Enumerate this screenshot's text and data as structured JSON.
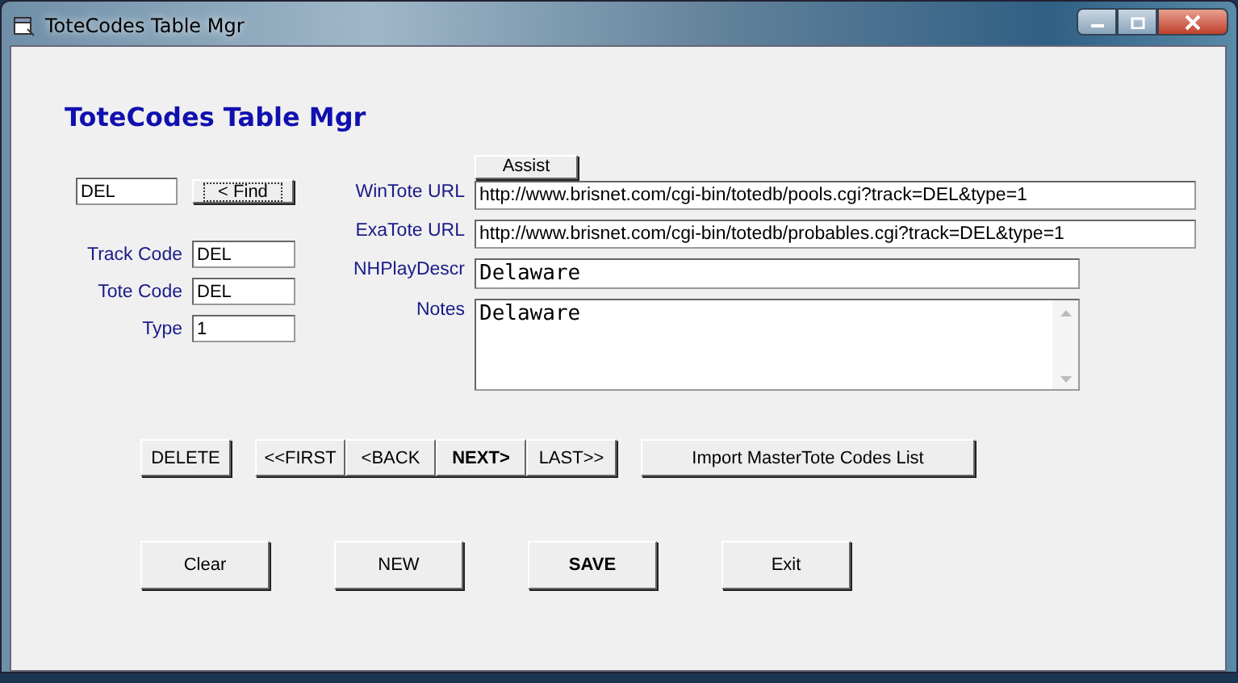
{
  "window": {
    "title": "ToteCodes Table Mgr"
  },
  "heading": "ToteCodes Table Mgr",
  "find": {
    "value": "DEL",
    "button": "< Find"
  },
  "codes": [
    {
      "label": "Track Code",
      "value": "DEL"
    },
    {
      "label": "Tote Code",
      "value": "DEL"
    },
    {
      "label": "Type",
      "value": "1"
    }
  ],
  "assist_button": "Assist",
  "details": [
    {
      "kind": "url",
      "label": "WinTote URL",
      "value": "http://www.brisnet.com/cgi-bin/totedb/pools.cgi?track=DEL&type=1"
    },
    {
      "kind": "url",
      "label": "ExaTote URL",
      "value": "http://www.brisnet.com/cgi-bin/totedb/probables.cgi?track=DEL&type=1"
    },
    {
      "kind": "line",
      "label": "NHPlayDescr",
      "value": "Delaware"
    },
    {
      "kind": "memo",
      "label": "Notes",
      "value": "Delaware"
    }
  ],
  "delete_button": "DELETE",
  "nav_buttons": [
    {
      "label": "<<FIRST",
      "default": false
    },
    {
      "label": "<BACK",
      "default": false
    },
    {
      "label": "NEXT>",
      "default": true
    },
    {
      "label": "LAST>>",
      "default": false
    }
  ],
  "import_button": "Import MasterTote Codes List",
  "action_buttons": [
    {
      "label": "Clear",
      "default": false
    },
    {
      "label": "NEW",
      "default": false
    },
    {
      "label": "SAVE",
      "default": true
    },
    {
      "label": "Exit",
      "default": false
    }
  ]
}
